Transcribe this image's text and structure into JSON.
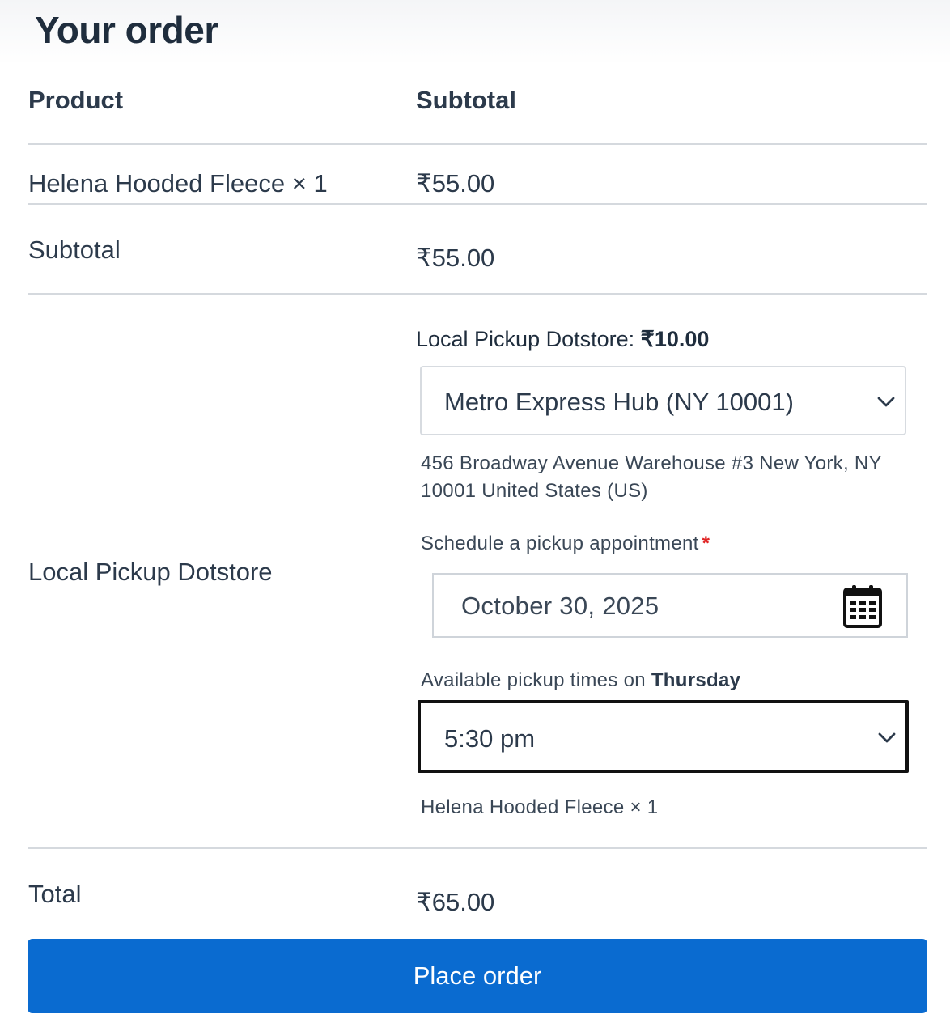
{
  "title": "Your order",
  "table": {
    "col_product": "Product",
    "col_subtotal": "Subtotal",
    "item": {
      "name": "Helena Hooded Fleece",
      "qty": "× 1",
      "price": "₹55.00"
    },
    "subtotal": {
      "label": "Subtotal",
      "value": "₹55.00"
    },
    "shipping": {
      "label": "Local Pickup Dotstore"
    },
    "total": {
      "label": "Total",
      "value": "₹65.00"
    }
  },
  "pickup": {
    "method_label": "Local Pickup Dotstore:",
    "method_price": "₹10.00",
    "location_selected": "Metro Express Hub (NY 10001)",
    "address": "456 Broadway Avenue Warehouse #3 New York, NY 10001 United States (US)",
    "schedule_label": "Schedule a pickup appointment",
    "required_mark": "*",
    "date_value": "October 30, 2025",
    "times_label": "Available pickup times on",
    "times_day": "Thursday",
    "time_selected": "5:30 pm",
    "item_note": "Helena Hooded Fleece × 1"
  },
  "actions": {
    "place_order": "Place order"
  },
  "colors": {
    "primary_button": "#0a6bd0",
    "required": "#e02424",
    "text": "#2c3a4b"
  },
  "icons": {
    "location_select": "chevron-down-icon",
    "date_picker": "calendar-icon",
    "time_select": "chevron-down-icon"
  }
}
